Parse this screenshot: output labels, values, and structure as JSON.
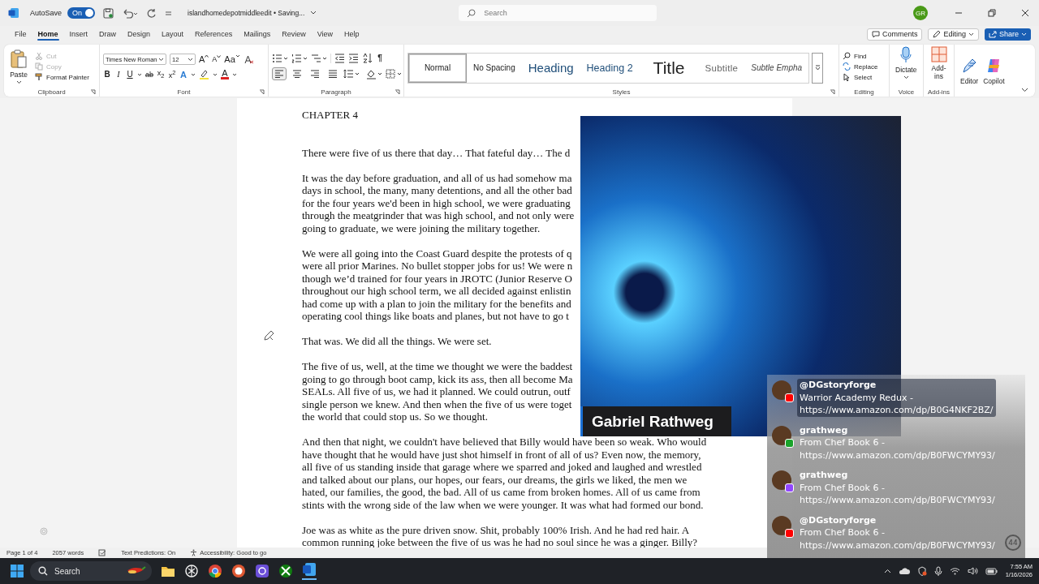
{
  "title_bar": {
    "autosave_label": "AutoSave",
    "autosave": {
      "on": true,
      "label": "On"
    },
    "document_title": "islandhomedepotmiddleedit • Saving...",
    "search": {
      "placeholder": "Search"
    },
    "avatar": "GR"
  },
  "tabs": [
    {
      "label": "File",
      "selected": false
    },
    {
      "label": "Home",
      "selected": true
    },
    {
      "label": "Insert",
      "selected": false
    },
    {
      "label": "Draw",
      "selected": false
    },
    {
      "label": "Design",
      "selected": false
    },
    {
      "label": "Layout",
      "selected": false
    },
    {
      "label": "References",
      "selected": false
    },
    {
      "label": "Mailings",
      "selected": false
    },
    {
      "label": "Review",
      "selected": false
    },
    {
      "label": "View",
      "selected": false
    },
    {
      "label": "Help",
      "selected": false
    }
  ],
  "actions": {
    "comments": "Comments",
    "mode": "Editing",
    "share": "Share"
  },
  "ribbon": {
    "clipboard": {
      "label": "Clipboard",
      "paste": "Paste",
      "items": [
        {
          "label": "Cut",
          "kind": "cut",
          "disabled": true
        },
        {
          "label": "Copy",
          "kind": "copy",
          "disabled": true
        },
        {
          "label": "Format Painter",
          "kind": "painter",
          "disabled": false
        }
      ]
    },
    "font": {
      "label": "Font",
      "family": "Times New Roman",
      "size": "12",
      "grow": "A",
      "shrink": "A",
      "case": "Aa",
      "buttons": [
        {
          "label": "B",
          "kind": "bold"
        },
        {
          "label": "I",
          "kind": "italic"
        },
        {
          "label": "U",
          "kind": "underline"
        },
        {
          "label": "ab",
          "kind": "strike"
        },
        {
          "label": "x$_{2}$",
          "kind": "sub"
        },
        {
          "label": "x$^{2}$",
          "kind": "sup"
        },
        {
          "label": "A",
          "kind": "effects"
        },
        {
          "kind": "highlight"
        },
        {
          "label": "A",
          "kind": "color"
        }
      ]
    },
    "paragraph": {
      "label": "Paragraph",
      "marks": "¶",
      "alignment": [
        {
          "kind": "left",
          "selected": true
        },
        {
          "kind": "center",
          "selected": false
        },
        {
          "kind": "right",
          "selected": false
        },
        {
          "kind": "justify",
          "selected": false
        }
      ]
    },
    "styles": {
      "label": "Styles",
      "items": [
        {
          "label": "Normal",
          "kind": "normal",
          "selected": true
        },
        {
          "label": "No Spacing",
          "kind": "normal",
          "selected": false
        },
        {
          "label": "Heading",
          "kind": "heading1",
          "selected": false
        },
        {
          "label": "Heading 2",
          "kind": "heading2",
          "selected": false
        },
        {
          "label": "Title",
          "kind": "title",
          "selected": false
        },
        {
          "label": "Subtitle",
          "kind": "subtitle",
          "selected": false
        },
        {
          "label": "Subtle Empha",
          "kind": "emphasis",
          "selected": false
        }
      ]
    },
    "editing": {
      "label": "Editing",
      "items": [
        {
          "label": "Find",
          "kind": "find"
        },
        {
          "label": "Replace",
          "kind": "replace"
        },
        {
          "label": "Select",
          "kind": "select"
        }
      ]
    },
    "voice": {
      "label": "Voice",
      "dictate": "Dictate"
    },
    "addins": {
      "label": "Add-ins",
      "button": "Add-ins"
    },
    "tools": [
      {
        "label": "Editor",
        "kind": "editor"
      },
      {
        "label": "Copilot",
        "kind": "copilot"
      }
    ]
  },
  "document": {
    "heading": "CHAPTER 4",
    "paragraphs": [
      {
        "lines": [
          "There were five of us there that day… That fateful day… The d"
        ]
      },
      {
        "lines": [
          "It was the day before graduation, and all of us had somehow ma",
          "days in school, the many, many detentions, and all the other bad",
          "for the four years we'd been in high school, we were graduating",
          "through the meatgrinder that was high school, and not only were",
          "going to graduate, we were joining the military together."
        ]
      },
      {
        "lines": [
          "We were all going into the Coast Guard despite the protests of q",
          "were all prior Marines. No bullet stopper jobs for us! We were n",
          "though we’d trained for four years in JROTC (Junior Reserve O",
          "throughout our high school term, we all decided against enlistin",
          "had come up with a plan to join the military for the benefits and",
          "operating cool things like boats and planes, but not have to go t"
        ]
      },
      {
        "lines": [
          "That was. We did all the things. We were set."
        ],
        "marker": true
      },
      {
        "lines": [
          "The five of us, well, at the time we thought we were the baddest",
          "going to go through boot camp, kick its ass, then all become Ma",
          "SEALs. All five of us, we had it planned. We could outrun, outf",
          "single person we knew. And then when the five of us were toget",
          "the world that could stop us. So we thought."
        ]
      },
      {
        "lines": [
          "And then that night, we couldn't have believed that Billy would have been so weak. Who would",
          "have thought that he would have just shot himself in front of all of us? Even now, the memory,",
          "all five of us standing inside that garage where we sparred and joked and laughed and wrestled",
          "and talked about our plans, our hopes, our fears, our dreams, the girls we liked, the men we",
          "hated, our families, the good, the bad. All of us came from broken homes. All of us came from",
          "stints with the wrong side of the law when we were younger. It was what had formed our bond."
        ]
      },
      {
        "lines": [
          "Joe was as white as the pure driven snow. Shit, probably 100% Irish. And he had red hair. A",
          "common running joke between the five of us was he had no soul since he was a ginger. Billy?"
        ]
      }
    ]
  },
  "webcam": {
    "caption": "Gabriel Rathweg"
  },
  "chat": {
    "count": "44",
    "messages": [
      {
        "author": "@DGstoryforge",
        "kind": "youtube",
        "lines": [
          "Warrior Academy Redux -",
          "https://www.amazon.com/dp/B0G4NKF2BZ/"
        ]
      },
      {
        "author": "grathweg",
        "kind": "kick",
        "lines": [
          "From Chef Book 6 -",
          "https://www.amazon.com/dp/B0FWCYMY93/"
        ]
      },
      {
        "author": "grathweg",
        "kind": "twitch",
        "lines": [
          "From Chef Book 6 -",
          "https://www.amazon.com/dp/B0FWCYMY93/"
        ]
      },
      {
        "author": "@DGstoryforge",
        "kind": "youtube",
        "lines": [
          "From Chef Book 6 -",
          "https://www.amazon.com/dp/B0FWCYMY93/"
        ]
      }
    ]
  },
  "status_bar": {
    "page": "Page 1 of 4",
    "words": "2057 words",
    "text_predictions": "Text Predictions: On",
    "accessibility": "Accessibility: Good to go"
  },
  "taskbar": {
    "search": {
      "placeholder": "Search"
    },
    "time": "7:55 AM",
    "date": "1/16/2026"
  }
}
